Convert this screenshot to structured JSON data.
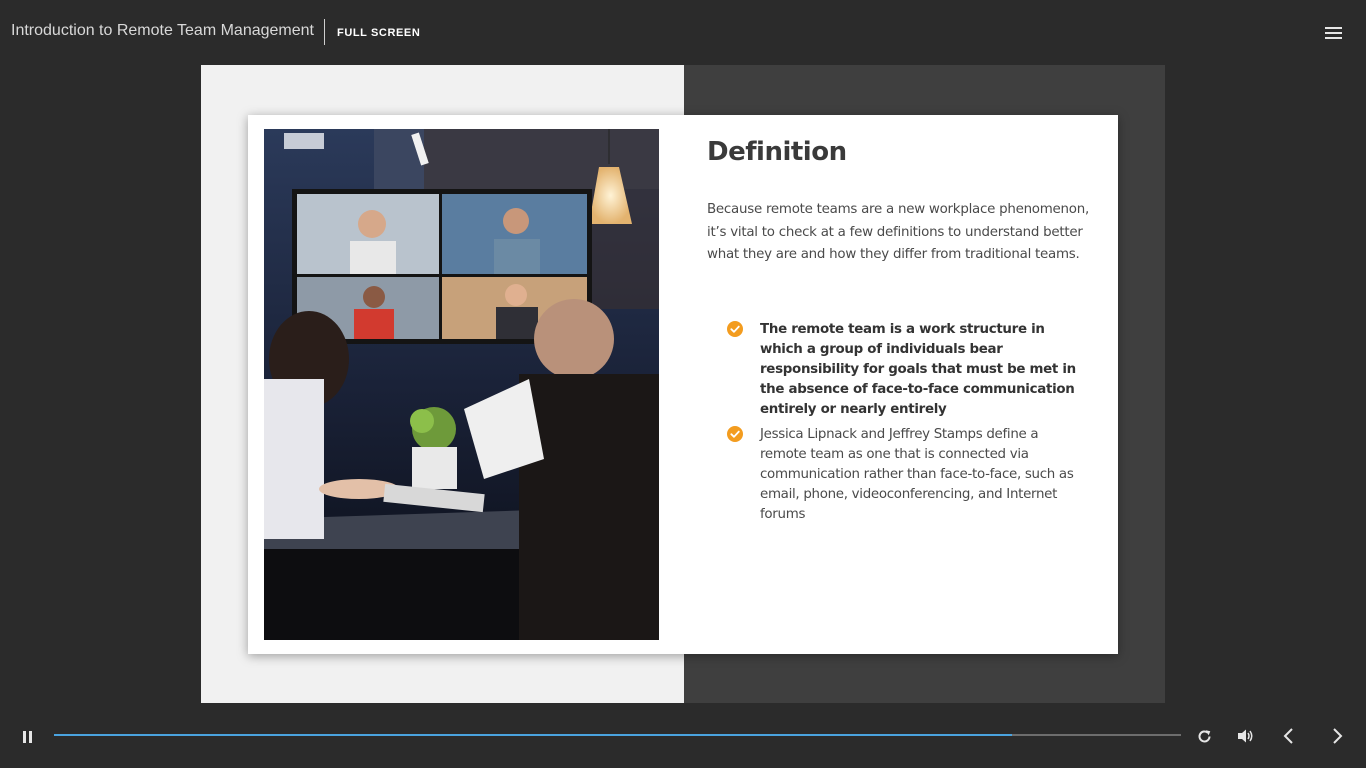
{
  "header": {
    "course_title": "Introduction to Remote Team Management",
    "fullscreen_label": "FULL SCREEN",
    "menu_icon": "hamburger-menu-icon"
  },
  "slide": {
    "heading": "Definition",
    "intro": "Because remote teams are a new workplace phenomenon, it’s vital to check at a few definitions to understand better what they are and how they differ from traditional teams.",
    "bullets": [
      {
        "text": "The remote team is a work structure in which a group of individuals bear responsibility for goals that must be met in the absence of face-to-face communication entirely or nearly entirely",
        "bold": true
      },
      {
        "text": "Jessica Lipnack and Jeffrey Stamps define a remote team as one that is connected via communication rather than face-to-face, such as email, phone, videoconferencing, and Internet forums",
        "bold": false
      }
    ],
    "bullet_icon": "checkmark-circle-icon",
    "image": "video-conference-meeting-photo"
  },
  "player": {
    "progress": 0.85,
    "icons": [
      "pause-icon",
      "replay-icon",
      "volume-icon",
      "previous-icon",
      "next-icon"
    ]
  },
  "colors": {
    "background": "#2b2b2b",
    "accent_orange": "#f39c1f",
    "progress_blue": "#4aa3df"
  }
}
